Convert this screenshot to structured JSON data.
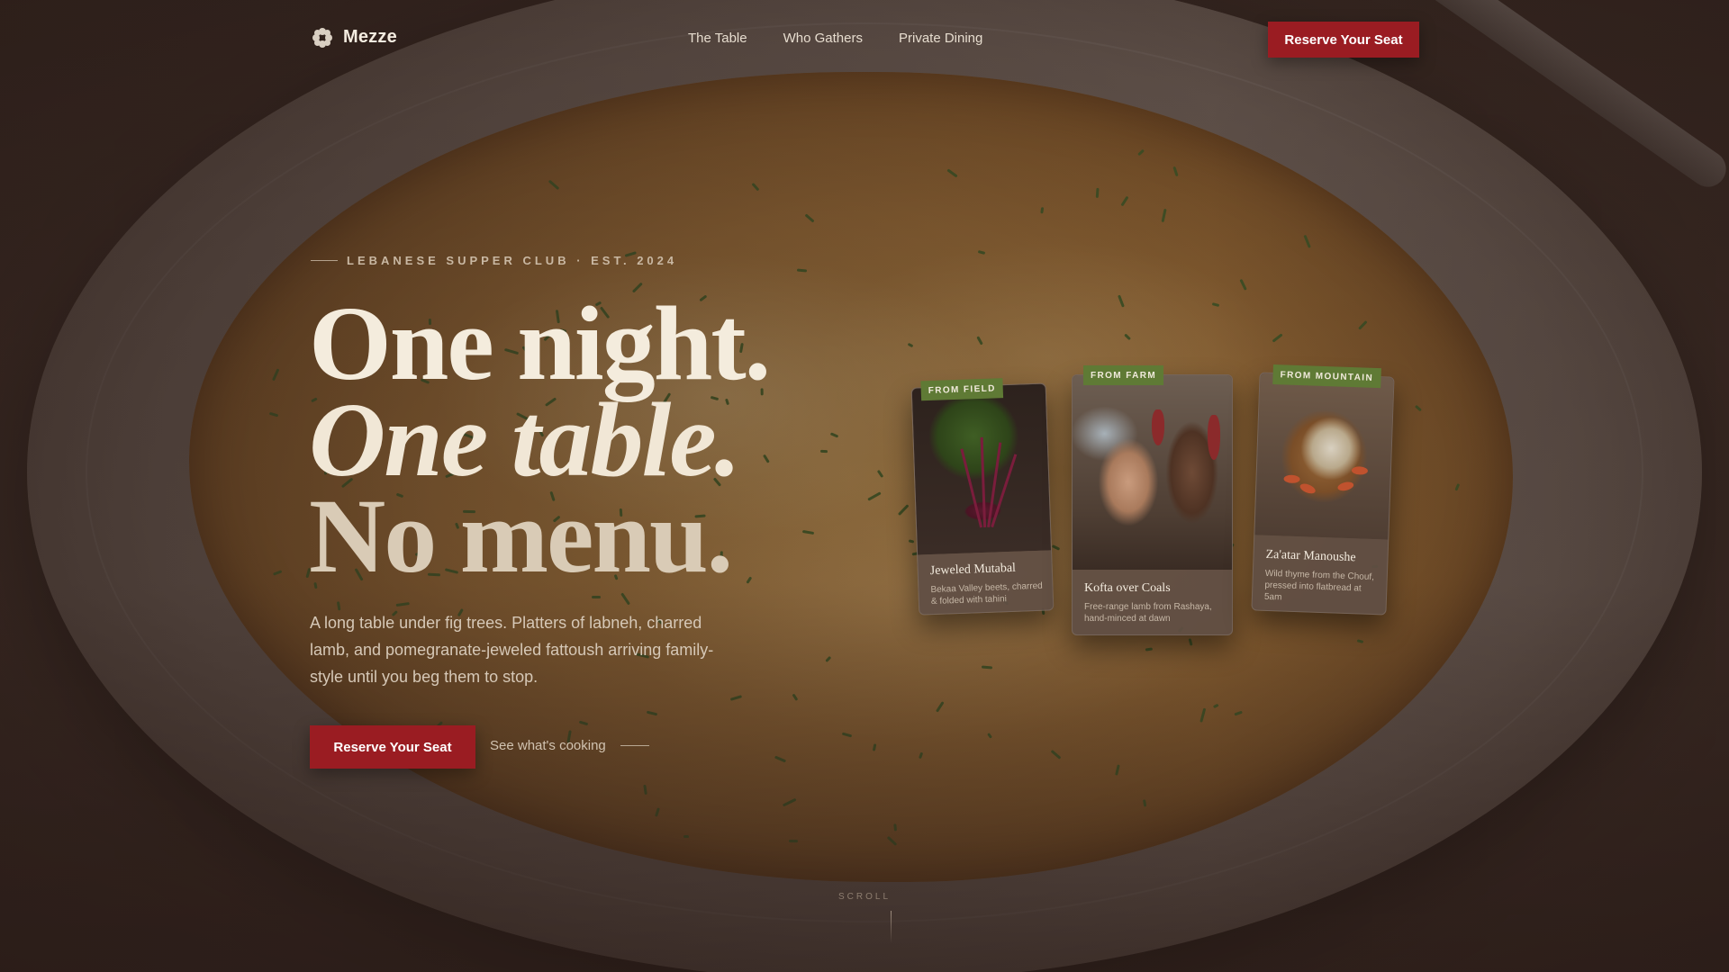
{
  "brand": {
    "name": "Mezze",
    "icon": "flower-icon"
  },
  "nav": {
    "links": [
      "The Table",
      "Who Gathers",
      "Private Dining"
    ],
    "cta": "Reserve Your Seat"
  },
  "hero": {
    "eyebrow": "LEBANESE SUPPER CLUB · EST. 2024",
    "line1": "One night.",
    "line2": "One table.",
    "line3": "No menu.",
    "lede": "A long table under fig trees. Platters of labneh, charred lamb, and pomegranate-jeweled fattoush arriving family-style until you beg them to stop.",
    "cta": "Reserve Your Seat",
    "secondary": "See what's cooking"
  },
  "cards": [
    {
      "tag": "FROM FIELD",
      "title": "Jeweled Mutabal",
      "desc": "Bekaa Valley beets, charred & folded with tahini",
      "image": "beets-photo"
    },
    {
      "tag": "FROM FARM",
      "title": "Kofta over Coals",
      "desc": "Free-range lamb from Rashaya, hand-minced at dawn",
      "image": "butcher-photo"
    },
    {
      "tag": "FROM MOUNTAIN",
      "title": "Za'atar Manoushe",
      "desc": "Wild thyme from the Chouf, pressed into flatbread at 5am",
      "image": "vegetable-basket-photo"
    }
  ],
  "scroll": {
    "label": "SCROLL"
  },
  "colors": {
    "accent": "#9a1c22",
    "tag": "#5f7a35",
    "cream": "#f4ecdd"
  }
}
